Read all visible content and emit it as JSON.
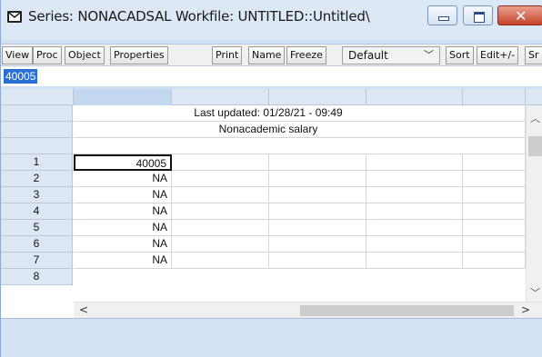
{
  "window": {
    "title": "Series: NONACADSAL   Workfile: UNTITLED::Untitled\\"
  },
  "toolbar": {
    "buttons": [
      "View",
      "Proc",
      "Object",
      "Properties",
      "Print",
      "Name",
      "Freeze",
      "Sort",
      "Edit+/-",
      "Sr"
    ],
    "display_select": "Default"
  },
  "editbar": {
    "value": "40005"
  },
  "grid": {
    "last_updated": "Last updated: 01/28/21 - 09:49",
    "description": "Nonacademic salary",
    "rows": [
      {
        "num": "1",
        "value": "40005"
      },
      {
        "num": "2",
        "value": "NA"
      },
      {
        "num": "3",
        "value": "NA"
      },
      {
        "num": "4",
        "value": "NA"
      },
      {
        "num": "5",
        "value": "NA"
      },
      {
        "num": "6",
        "value": "NA"
      },
      {
        "num": "7",
        "value": "NA"
      },
      {
        "num": "8",
        "value": ""
      }
    ]
  },
  "icons": {
    "window": "envelope-icon",
    "minimize": "minimize-icon",
    "maximize": "maximize-icon",
    "close": "close-icon",
    "dropdown": "chevron-down-icon",
    "scroll_up": "chevron-up-icon",
    "scroll_down": "chevron-down-icon",
    "scroll_left": "chevron-left-icon",
    "scroll_right": "chevron-right-icon"
  },
  "colors": {
    "selection": "#2a6fd4",
    "close_button": "#c7432a",
    "header_bg": "#dde7f3"
  }
}
